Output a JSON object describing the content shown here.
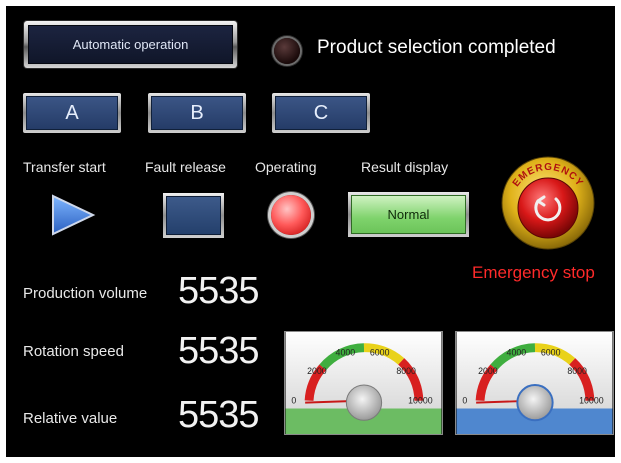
{
  "top": {
    "auto_button_label": "Automatic operation",
    "product_status_text": "Product selection completed"
  },
  "selection_buttons": [
    {
      "label": "A"
    },
    {
      "label": "B"
    },
    {
      "label": "C"
    }
  ],
  "controls": {
    "transfer_start_label": "Transfer start",
    "fault_release_label": "Fault release",
    "operating_label": "Operating",
    "result_display_label": "Result display",
    "result_value": "Normal"
  },
  "emergency": {
    "ring_text": "EMERGENCY",
    "label": "Emergency stop"
  },
  "readouts": [
    {
      "label": "Production volume",
      "value": "5535"
    },
    {
      "label": "Rotation speed",
      "value": "5535"
    },
    {
      "label": "Relative value",
      "value": "5535"
    }
  ],
  "gauges": [
    {
      "ticks": [
        "0",
        "2000",
        "4000",
        "6000",
        "8000",
        "10000"
      ],
      "footer_color": "#6cbc63"
    },
    {
      "ticks": [
        "0",
        "2000",
        "4000",
        "6000",
        "8000",
        "10000"
      ],
      "footer_color": "#4f87cf"
    }
  ],
  "colors": {
    "background": "#000000",
    "emergency_text": "#ff2a2a",
    "operating_lamp": "#ff5a5a",
    "result_green": "#7fd36c"
  },
  "icons": {
    "transfer": "play-triangle-icon",
    "status_lamp": "indicator-lamp-icon",
    "estop": "emergency-stop-icon"
  }
}
